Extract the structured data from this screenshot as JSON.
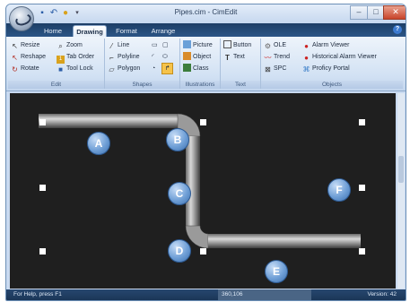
{
  "window": {
    "title": "Pipes.cim - CimEdit",
    "minimize": "–",
    "maximize": "□",
    "close": "✕"
  },
  "quick_access": [
    "save-icon",
    "undo-icon",
    "light-icon",
    "dropdown-icon"
  ],
  "tabs": [
    "Home",
    "Drawing",
    "Format",
    "Arrange"
  ],
  "active_tab": "Drawing",
  "help": "?",
  "ribbon": {
    "edit": {
      "label": "Edit",
      "items": [
        "Resize",
        "Zoom",
        "Reshape",
        "Tab Order",
        "Rotate",
        "Tool Lock"
      ]
    },
    "shapes": {
      "label": "Shapes",
      "items": [
        "Line",
        "Polyline",
        "Polygon"
      ]
    },
    "illustrations": {
      "label": "Illustrations",
      "items": [
        "Picture",
        "Object",
        "Class"
      ]
    },
    "text": {
      "label": "Text",
      "items": [
        "Button",
        "Text"
      ]
    },
    "objects": {
      "label": "Objects",
      "items": [
        "OLE",
        "Alarm Viewer",
        "Trend",
        "Historical Alarm Viewer",
        "SPC",
        "Proficy Portal"
      ]
    }
  },
  "canvas": {
    "labels": [
      "A",
      "B",
      "C",
      "D",
      "E",
      "F"
    ]
  },
  "status": {
    "help": "For Help, press F1",
    "coords": "360,106",
    "version": "Version: 42"
  },
  "colors": {
    "canvas": "#1f1f1f",
    "bubble": "#5b8fd0",
    "pipe": "#8a8a8a",
    "ribbon": "#d3e2f4"
  }
}
